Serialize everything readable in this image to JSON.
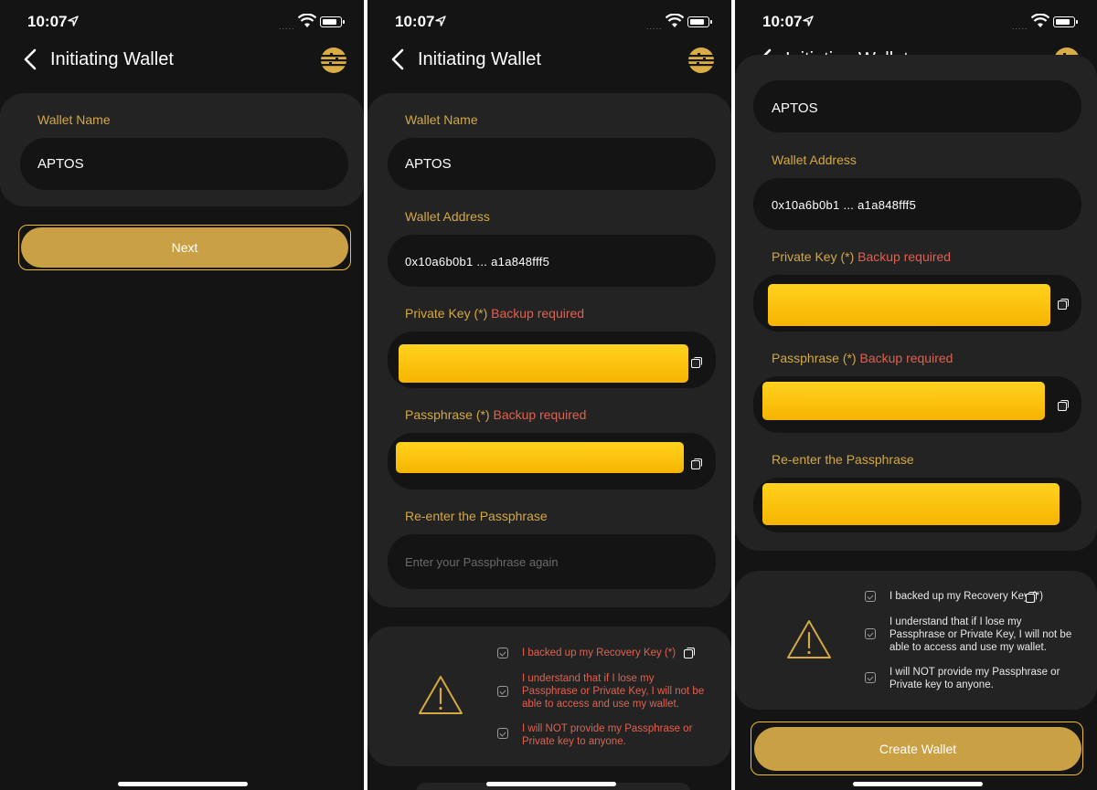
{
  "status": {
    "time": "10:07",
    "signal": "....."
  },
  "nav": {
    "title": "Initiating Wallet"
  },
  "form": {
    "wallet_name_label": "Wallet Name",
    "wallet_name_value": "APTOS",
    "wallet_address_label": "Wallet Address",
    "wallet_address_value": "0x10a6b0b1 ... a1a848fff5",
    "private_key_label": "Private Key (*)",
    "passphrase_label": "Passphrase (*)",
    "backup_required": "Backup required",
    "reenter_label": "Re-enter the Passphrase",
    "reenter_placeholder": "Enter your Passphrase again"
  },
  "buttons": {
    "next": "Next",
    "create_wallet": "Create Wallet"
  },
  "acknowledgements": {
    "backup": "I backed up my Recovery Key (*)",
    "understand": "I understand that if I lose my Passphrase or Private Key, I will not be able to access and use my wallet.",
    "not_provide": "I will NOT provide my Passphrase or Private key to anyone."
  },
  "colors": {
    "accent": "#c9a044",
    "label": "#d4a843",
    "required": "#e0614f",
    "redaction": "#ffd21f"
  },
  "icons": [
    "back-chevron-icon",
    "aptos-logo-icon",
    "wifi-icon",
    "battery-icon",
    "location-arrow-icon",
    "copy-icon",
    "checkbox-icon",
    "warning-icon"
  ]
}
